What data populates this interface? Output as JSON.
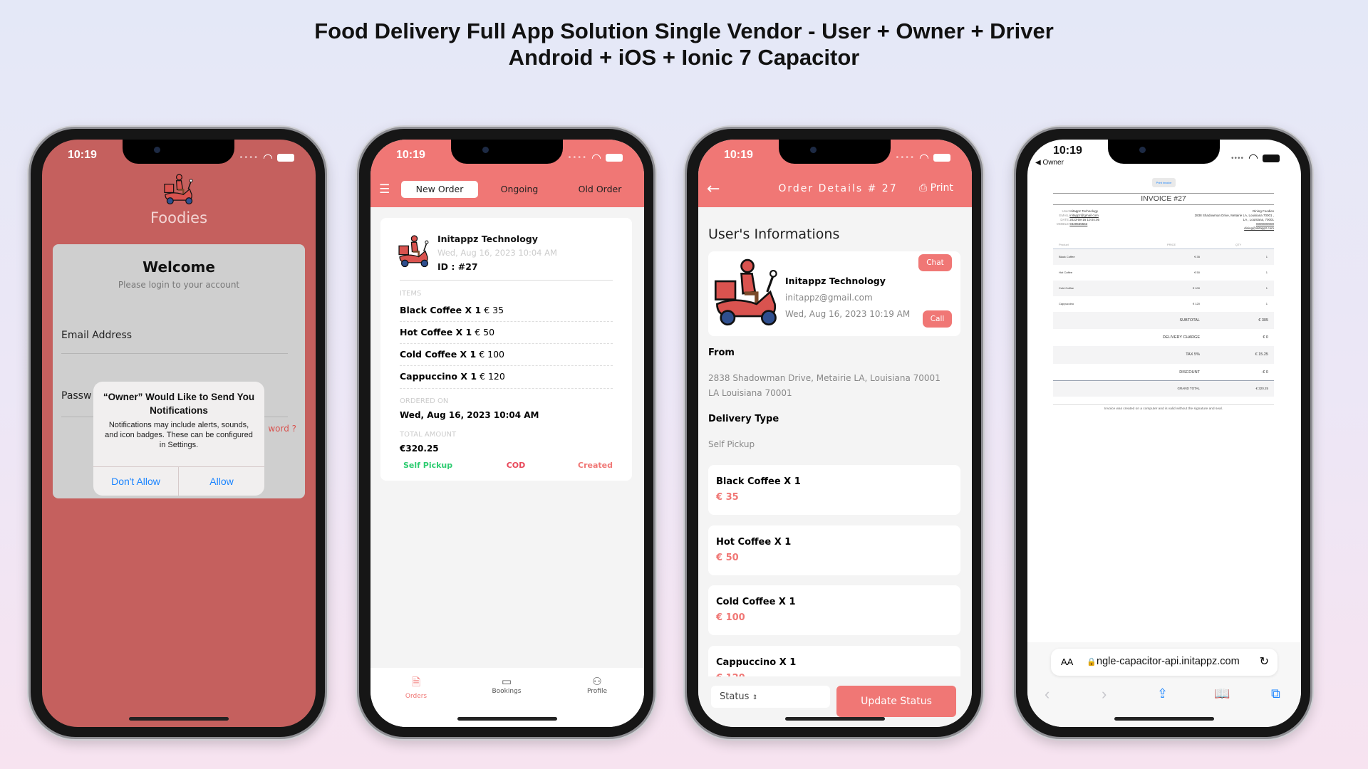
{
  "page": {
    "title_line1": "Food Delivery Full App Solution Single Vendor - User + Owner + Driver",
    "title_line2": "Android + iOS + Ionic 7 Capacitor"
  },
  "colors": {
    "brand": "#f07775",
    "login_bg": "#c5605e",
    "success": "#2ecc71",
    "danger": "#e8485a",
    "ios_blue": "#1a84ff"
  },
  "status_bar": {
    "time": "10:19"
  },
  "login": {
    "app_name": "Foodies",
    "welcome": "Welcome",
    "subtitle": "Please login to your account",
    "email_label": "Email Address",
    "password_label": "Passw",
    "forgot": "word ?",
    "alert": {
      "title": "“Owner” Would Like to Send You Notifications",
      "body": "Notifications may include alerts, sounds, and icon badges. These can be configured in Settings.",
      "deny": "Don't Allow",
      "allow": "Allow"
    }
  },
  "orders": {
    "tabs": [
      "New Order",
      "Ongoing",
      "Old Order"
    ],
    "card": {
      "name": "Initappz Technology",
      "date": "Wed, Aug 16, 2023 10:04 AM",
      "id": "ID : #27",
      "items_label": "ITEMS",
      "items": [
        {
          "name": "Black Coffee X 1",
          "price": "€ 35"
        },
        {
          "name": "Hot Coffee X 1",
          "price": "€ 50"
        },
        {
          "name": "Cold Coffee X 1",
          "price": "€ 100"
        },
        {
          "name": "Cappuccino X 1",
          "price": "€ 120"
        }
      ],
      "ordered_on_label": "ORDERED ON",
      "ordered_on": "Wed, Aug 16, 2023 10:04 AM",
      "total_label": "TOTAL AMOUNT",
      "total": "€320.25",
      "delivery": "Self Pickup",
      "payment": "COD",
      "status": "Created"
    },
    "bottom_tabs": [
      "Orders",
      "Bookings",
      "Profile"
    ]
  },
  "details": {
    "title": "Order Details # 27",
    "print": "Print",
    "section_user": "User's Informations",
    "user": {
      "name": "Initappz Technology",
      "email": "initappz@gmail.com",
      "date": "Wed, Aug 16, 2023 10:19 AM",
      "chat": "Chat",
      "call": "Call"
    },
    "from_label": "From",
    "address_line1": "2838 Shadowman Drive, Metairie LA, Louisiana 70001",
    "address_line2": "LA Louisiana 70001",
    "delivery_label": "Delivery Type",
    "delivery": "Self Pickup",
    "items": [
      {
        "name": "Black Coffee X 1",
        "price": "€ 35"
      },
      {
        "name": "Hot Coffee X 1",
        "price": "€ 50"
      },
      {
        "name": "Cold Coffee X 1",
        "price": "€ 100"
      },
      {
        "name": "Cappuccino X 1",
        "price": "€ 120"
      }
    ],
    "status_select": "Status",
    "update_button": "Update Status"
  },
  "invoice": {
    "back": "◀ Owner",
    "print_button": "Print invoice",
    "title": "INVOICE #27",
    "meta": [
      {
        "k": "User",
        "v": "Initappz Technology"
      },
      {
        "k": "EMAIL",
        "v": "initappz@gmail.com"
      },
      {
        "k": "DATE",
        "v": "2023-08-16 10:04:05"
      },
      {
        "k": "MOBILE",
        "v": "9420565553"
      }
    ],
    "store": [
      "Dining Foodies",
      "2838 Shadowman Drive, Metairie LA, Louisiana 70001 ,",
      "LA , Louisiana, 70001",
      "0000000000",
      "dining@initappz.com"
    ],
    "headers": [
      "Product",
      "PRICE",
      "QTY"
    ],
    "rows": [
      {
        "p": "Black Coffee",
        "price": "€ 35",
        "qty": "1"
      },
      {
        "p": "Hot Coffee",
        "price": "€ 50",
        "qty": "1"
      },
      {
        "p": "Cold Coffee",
        "price": "€ 100",
        "qty": "1"
      },
      {
        "p": "Cappuccino",
        "price": "€ 120",
        "qty": "1"
      }
    ],
    "summary": [
      {
        "k": "SUBTOTAL",
        "v": "€ 305"
      },
      {
        "k": "DELIVERY CHARGE",
        "v": "€ 0"
      },
      {
        "k": "TAX 5%",
        "v": "€ 15.25"
      },
      {
        "k": "DISCOUNT",
        "v": "-€ 0"
      },
      {
        "k": "GRAND TOTAL",
        "v": "€ 320.25"
      }
    ],
    "footer": "Invoice was created on a computer and is valid without the signature and seal.",
    "url": "ngle-capacitor-api.initappz.com",
    "text_size": "AA"
  }
}
